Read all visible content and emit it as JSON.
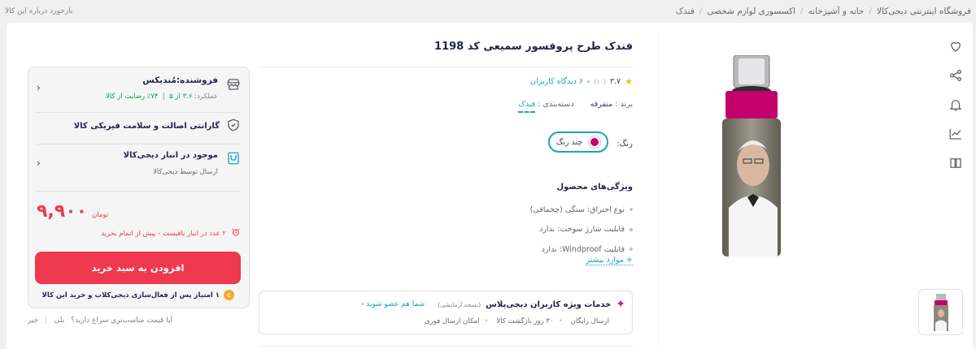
{
  "breadcrumb": {
    "items": [
      "فروشگاه اینترنتی دیجی‌کالا",
      "خانه و آشپزخانه",
      "اکسسوری لوازم شخصی",
      "فندک"
    ]
  },
  "feedback": {
    "label": "بازخورد درباره این کالا"
  },
  "product": {
    "title": "فندک طرح پروفسور سمیعی کد 1198",
    "rating": "۳.۷",
    "rating_count": "(۱۰)",
    "reviews": "۶ دیدگاه کاربران",
    "brand_label": "برند :",
    "brand_value": "متفرقه",
    "category_label": "دسته‌بندی",
    "category_value": "فندک",
    "color_label": "رنگ:",
    "color_option": "چند رنگ",
    "color_hex": "#c4006c",
    "features_title": "ویژگی‌های محصول",
    "features": [
      "نوع احتراق: سنگی (چخماقی)",
      "قابلیت شارژ سوخت: ندارد",
      "قابلیت Windproof: ندارد"
    ],
    "more_label": "+ موارد بیشتر"
  },
  "club": {
    "title": "خدمات ویژه کاربران دیجی‌پلاس",
    "tag": "(نسخه آزمایشی)",
    "join_label": "شما هم عضو شوید ›",
    "perks": [
      "ارسال رایگان",
      "۳۰ روز بازگشت کالا",
      "امکان ارسال فوری"
    ]
  },
  "buybox": {
    "seller_name": "فروشنده:مُندیکس",
    "seller_score_label": "عملکرد:",
    "seller_score": "۳.۶ از ۵",
    "seller_satisfaction": "۷۴٪ رضایت از کالا",
    "guarantee": "گارانتی اصالت و سلامت فیزیکی کالا",
    "stock_title": "موجود در انبار دیجی‌کالا",
    "stock_sub": "ارسال توسط دیجی‌کالا",
    "price": "۹,۹۰۰",
    "currency": "تومان",
    "stock_warning": "۲ عدد در انبار باقیست - پیش از اتمام بخرید",
    "add_to_cart": "افزودن به سبد خرید",
    "club_points": "۱ امتیاز پس از فعال‌سازی دیجی‌کلاب و خرید این کالا",
    "club_coin": "c",
    "accent": "#ef394e"
  },
  "price_question": {
    "text": "آیا قیمت مناسب‌تری سراغ دارید؟",
    "yes": "بلی",
    "no": "خیر"
  }
}
